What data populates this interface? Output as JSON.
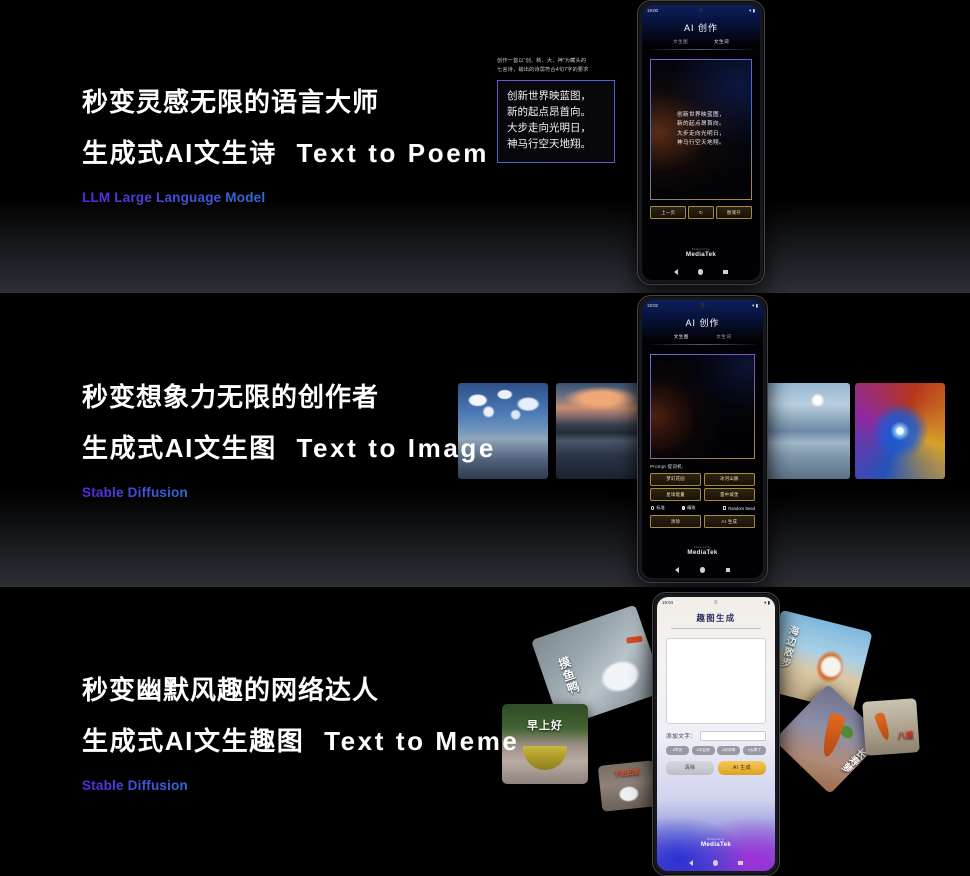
{
  "sections": [
    {
      "heading_line1": "秒变灵感无限的语言大师",
      "heading_line2_cn": "生成式AI文生诗",
      "heading_line2_en": "Text to Poem",
      "subtitle": "LLM Large Language Model",
      "accent_from": "#5a28e0",
      "accent_to": "#2e6fd6"
    },
    {
      "heading_line1": "秒变想象力无限的创作者",
      "heading_line2_cn": "生成式AI文生图",
      "heading_line2_en": "Text to Image",
      "subtitle": "Stable Diffusion",
      "accent_from": "#5a28e0",
      "accent_to": "#2e6fd6"
    },
    {
      "heading_line1": "秒变幽默风趣的网络达人",
      "heading_line2_cn": "生成式AI文生趣图",
      "heading_line2_en": "Text to Meme",
      "subtitle": "Stable Diffusion",
      "accent_from": "#5a28e0",
      "accent_to": "#2e6fd6"
    }
  ],
  "prompt_card": {
    "note_line1": "创作一首以“创、新、大、神”为藏头的",
    "note_line2": "七言诗，输出的诗需符合4句7字的要求",
    "poem": [
      "创新世界映蓝图，",
      "新的起点昂首向。",
      "大步走向光明日，",
      "神马行空天地翔。"
    ]
  },
  "phone1": {
    "status_time": "19:00",
    "status_icons": "▾ ▮",
    "app_title": "AI 创作",
    "tab_image": "文生图",
    "tab_text": "文生词",
    "poem": [
      "创新世界映蓝图，",
      "新的起点昂首向。",
      "大步走向光明日，",
      "神马行空天地翔。"
    ],
    "btn_prev": "上一页",
    "btn_refresh": "↻",
    "btn_save": "图储存",
    "brand_powered": "Powered by",
    "brand_name": "MediaTek"
  },
  "phone2": {
    "status_time": "19:02",
    "status_icons": "▾ ▮",
    "app_title": "AI 创作",
    "tab_image": "文生图",
    "tab_text": "文生词",
    "prompt_label": "Prompt 提词机:",
    "chips": [
      "梦幻花园",
      "冰河山脉",
      "星球能量",
      "雲中城堡"
    ],
    "opt_standard": "标准",
    "opt_fine": "精致",
    "opt_random_seed": "Random Seed",
    "btn_clear": "清除",
    "btn_generate": "AI 生成",
    "brand_powered": "Powered by",
    "brand_name": "MediaTek"
  },
  "phone3": {
    "status_time": "19:04",
    "status_icons": "▾ ▮",
    "app_title": "趣图生成",
    "input_label": "添加文字：",
    "input_value": "",
    "chips": [
      "#早安",
      "#不会吧",
      "#好帅啊",
      "#太棒了"
    ],
    "btn_clear": "清除",
    "btn_generate": "AI 生成",
    "brand_powered": "Powered by",
    "brand_name": "MediaTek"
  },
  "thumbnails": [
    {
      "name": "clouds-over-sea"
    },
    {
      "name": "fjord-sunset"
    },
    {
      "name": "icy-mountain-lake"
    },
    {
      "name": "cosmic-nebula"
    }
  ],
  "memes": [
    {
      "caption": "摸鱼鸭"
    },
    {
      "caption": "早上好"
    },
    {
      "caption": "下班回家"
    },
    {
      "caption": "海边散步"
    },
    {
      "caption": "长寿萝"
    },
    {
      "caption": "八道"
    }
  ]
}
